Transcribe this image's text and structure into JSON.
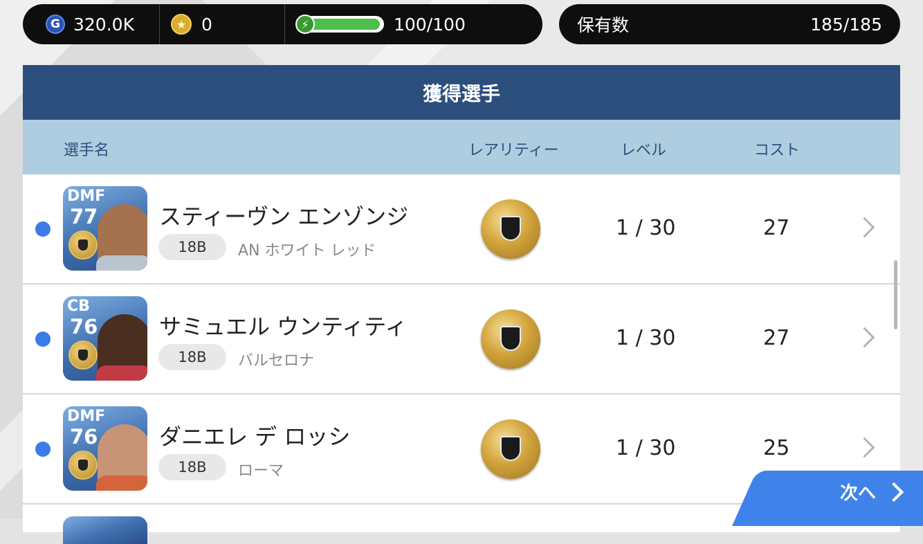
{
  "status_bar": {
    "gp_icon": "G",
    "gp_value": "320.0K",
    "coin_icon": "★",
    "coin_value": "0",
    "energy_icon": "⚡",
    "energy_fraction": 1.0,
    "energy_value": "100/100",
    "owned_label": "保有数",
    "owned_value": "185/185"
  },
  "panel": {
    "title": "獲得選手",
    "columns": {
      "name": "選手名",
      "rarity": "レアリティー",
      "level": "レベル",
      "cost": "コスト"
    }
  },
  "players": [
    {
      "position": "DMF",
      "rating": "77",
      "name": "スティーヴン エンゾンジ",
      "version": "18B",
      "team": "AN ホワイト レッド",
      "rarity": "gold-ball-icon",
      "level": "1 / 30",
      "cost": "27"
    },
    {
      "position": "CB",
      "rating": "76",
      "name": "サミュエル ウンティティ",
      "version": "18B",
      "team": "バルセロナ",
      "rarity": "gold-ball-icon",
      "level": "1 / 30",
      "cost": "27"
    },
    {
      "position": "DMF",
      "rating": "76",
      "name": "ダニエレ デ ロッシ",
      "version": "18B",
      "team": "ローマ",
      "rarity": "gold-ball-icon",
      "level": "1 / 30",
      "cost": "25"
    }
  ],
  "next_button": {
    "label": "次へ"
  },
  "colors": {
    "header": "#2c4e7c",
    "column_header": "#afcde0",
    "accent": "#3f83ea",
    "unread_dot": "#3a7be8"
  }
}
